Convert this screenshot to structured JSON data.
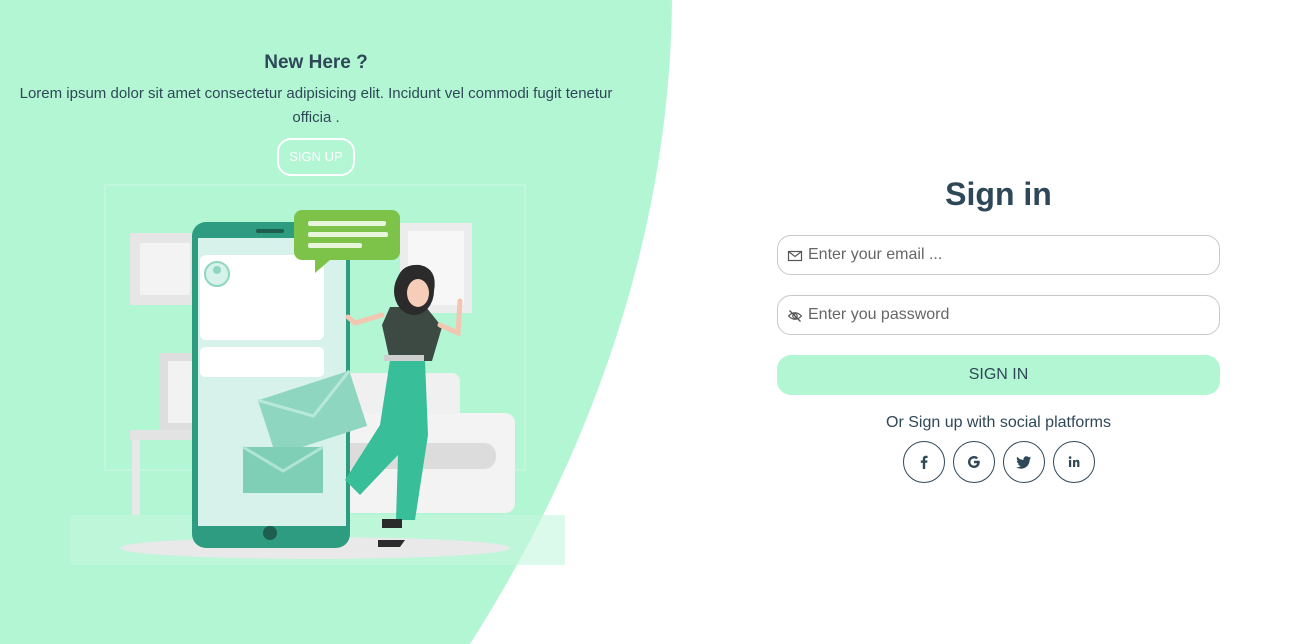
{
  "left": {
    "title": "New Here ?",
    "text": "Lorem ipsum dolor sit amet consectetur adipisicing elit. Incidunt vel commodi fugit tenetur officia .",
    "signup_label": "SIGN UP"
  },
  "form": {
    "title": "Sign in",
    "email_placeholder": "Enter your email ...",
    "password_placeholder": "Enter you password",
    "signin_label": "SIGN IN",
    "social_text": "Or Sign up with social platforms"
  },
  "socials": [
    "facebook-icon",
    "google-icon",
    "twitter-icon",
    "linkedin-icon"
  ],
  "colors": {
    "accent": "#b3f6d3",
    "text": "#2f4858",
    "illustration_green": "#2e9c80",
    "bubble_green": "#7dc34a"
  }
}
